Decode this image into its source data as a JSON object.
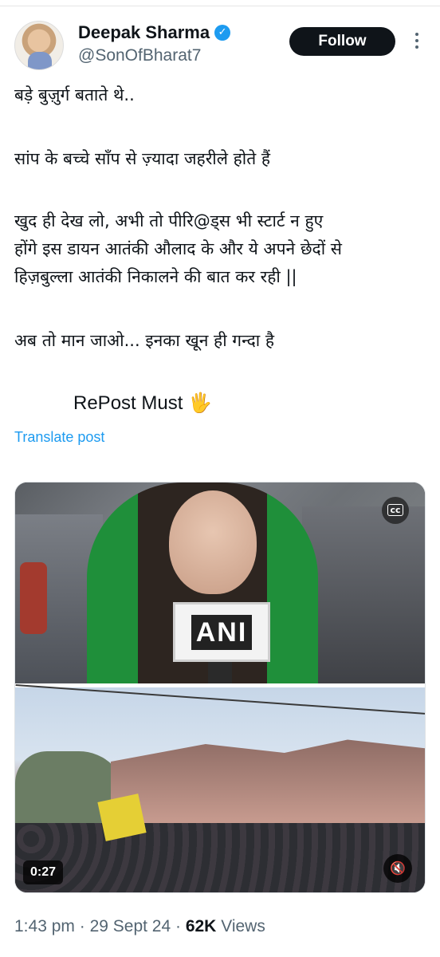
{
  "author": {
    "name": "Deepak Sharma",
    "handle": "@SonOfBharat7",
    "verified_icon": "verified-badge-icon"
  },
  "actions": {
    "follow_label": "Follow",
    "more_icon": "more-options-icon"
  },
  "tweet": {
    "lines": [
      "बड़े बुज़ुर्ग बताते थे..",
      "सांप के बच्चे साँप से ज़्यादा जहरीले होते हैं",
      "खुद ही देख लो, अभी तो पीरि@ड्स भी स्टार्ट न हुए",
      "होंगे इस डायन आतंकी औलाद के और ये अपने छेदों से",
      "हिज़बुल्ला आतंकी निकालने की बात कर रही ||",
      "अब तो मान जाओ... इनका खून ही गन्दा है",
      "RePost Must 🖐"
    ],
    "translate_label": "Translate post"
  },
  "media": {
    "mic_label": "ANI",
    "cc_label": "cc",
    "duration": "0:27",
    "volume_icon": "volume-muted-icon"
  },
  "meta": {
    "time": "1:43 pm",
    "sep1": " · ",
    "date": "29 Sept 24",
    "sep2": " · ",
    "views_count": "62K",
    "views_label": " Views"
  },
  "colors": {
    "accent": "#1d9bf0",
    "text": "#0f1419",
    "muted": "#536471",
    "button": "#0f1419"
  }
}
